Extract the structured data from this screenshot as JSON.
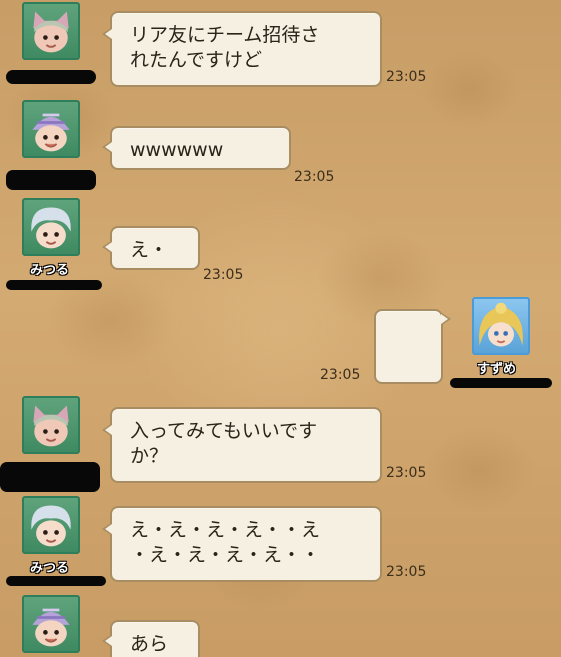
{
  "messages": [
    {
      "id": "m1",
      "side": "left",
      "avatar": "cat-hat-character-icon",
      "name": "",
      "text": "リア友にチーム招待さ\nれたんですけど",
      "time": "23:05"
    },
    {
      "id": "m2",
      "side": "left",
      "avatar": "striped-cap-character-icon",
      "name": "",
      "text": "wwwwww",
      "time": "23:05"
    },
    {
      "id": "m3",
      "side": "left",
      "avatar": "silver-hair-character-icon",
      "name": "みつる",
      "text": "え・",
      "time": "23:05"
    },
    {
      "id": "m4",
      "side": "right",
      "avatar": "blonde-character-icon",
      "name": "すずめ",
      "text": "",
      "time": "23:05"
    },
    {
      "id": "m5",
      "side": "left",
      "avatar": "cat-hat-character-icon",
      "name": "",
      "text": "入ってみてもいいです\nか？",
      "time": "23:05"
    },
    {
      "id": "m6",
      "side": "left",
      "avatar": "silver-hair-character-icon",
      "name": "みつる",
      "text": "え・え・え・え・・え\n・え・え・え・え・・",
      "time": "23:05"
    },
    {
      "id": "m7",
      "side": "left",
      "avatar": "striped-cap-character-icon",
      "name": "",
      "text": "あら",
      "time": ""
    }
  ]
}
